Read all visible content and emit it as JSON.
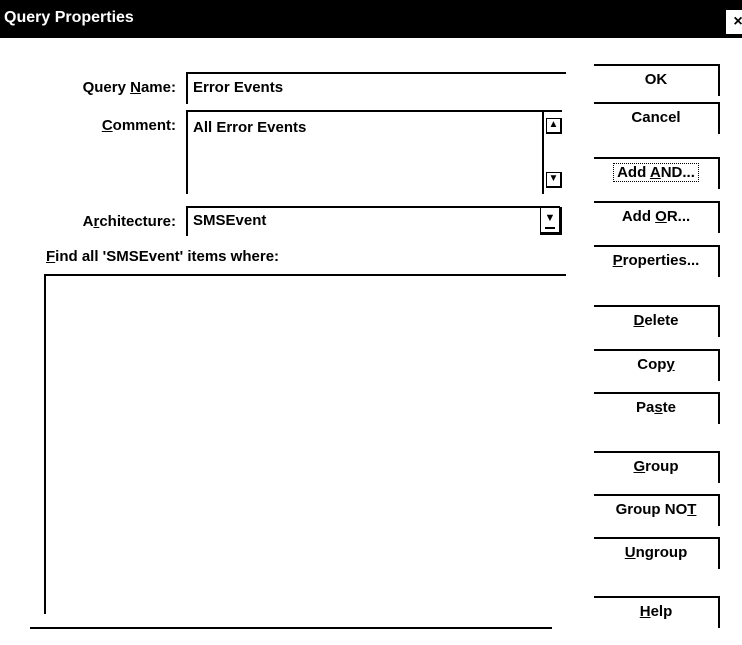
{
  "window": {
    "title": "Query Properties",
    "close_glyph": "×"
  },
  "form": {
    "query_name_label": {
      "pre": "Query ",
      "key": "N",
      "post": "ame:"
    },
    "query_name_value": "Error Events",
    "comment_label": {
      "pre": "",
      "key": "C",
      "post": "omment:"
    },
    "comment_value": "All Error Events",
    "architecture_label": {
      "pre": "A",
      "key": "r",
      "post": "chitecture:"
    },
    "architecture_value": "SMSEvent",
    "find_label": {
      "pre": "",
      "key": "F",
      "post": "ind all 'SMSEvent' items where:"
    }
  },
  "glyphs": {
    "up": "▲",
    "down": "▼"
  },
  "buttons": {
    "ok": {
      "pre": "OK",
      "key": "",
      "post": ""
    },
    "cancel": {
      "pre": "Cancel",
      "key": "",
      "post": ""
    },
    "add_and": {
      "pre": "Add ",
      "key": "A",
      "post": "ND..."
    },
    "add_or": {
      "pre": "Add ",
      "key": "O",
      "post": "R..."
    },
    "properties": {
      "pre": "",
      "key": "P",
      "post": "roperties..."
    },
    "delete": {
      "pre": "",
      "key": "D",
      "post": "elete"
    },
    "copy": {
      "pre": "Cop",
      "key": "y",
      "post": ""
    },
    "paste": {
      "pre": "Pa",
      "key": "s",
      "post": "te"
    },
    "group": {
      "pre": "",
      "key": "G",
      "post": "roup"
    },
    "group_not": {
      "pre": "Group NO",
      "key": "T",
      "post": ""
    },
    "ungroup": {
      "pre": "",
      "key": "U",
      "post": "ngroup"
    },
    "help": {
      "pre": "",
      "key": "H",
      "post": "elp"
    }
  }
}
